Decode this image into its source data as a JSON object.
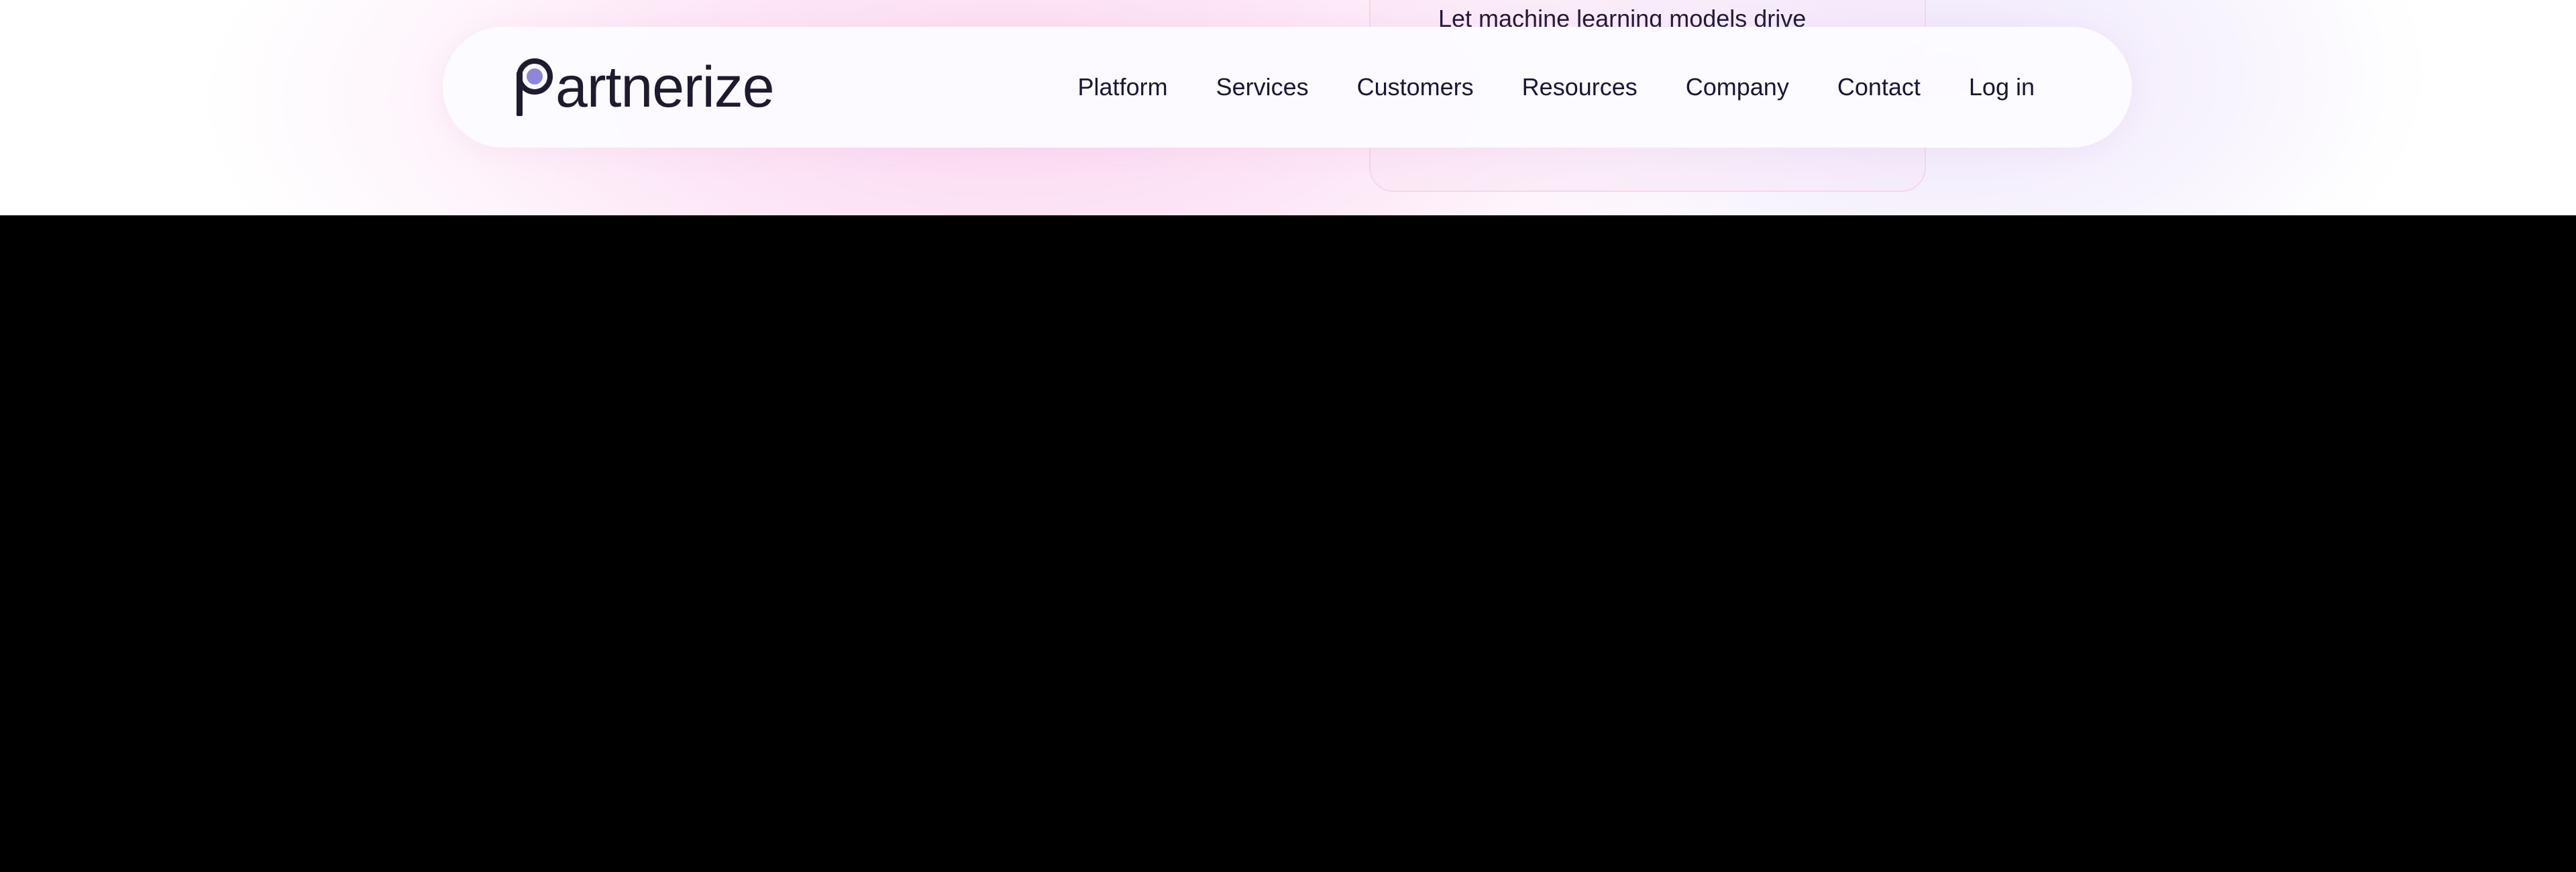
{
  "promo": {
    "text": "Let machine learning models drive"
  },
  "brand": {
    "logo_initial": "P",
    "logo_rest": "artnerize",
    "logo_dot_color": "#8f86d8"
  },
  "nav": {
    "items": [
      {
        "label": "Platform"
      },
      {
        "label": "Services"
      },
      {
        "label": "Customers"
      },
      {
        "label": "Resources"
      },
      {
        "label": "Company"
      },
      {
        "label": "Contact"
      },
      {
        "label": "Log in"
      }
    ]
  },
  "colors": {
    "text": "#1b1632",
    "background": "#000000",
    "hero_pink": "#fbd8f1"
  }
}
